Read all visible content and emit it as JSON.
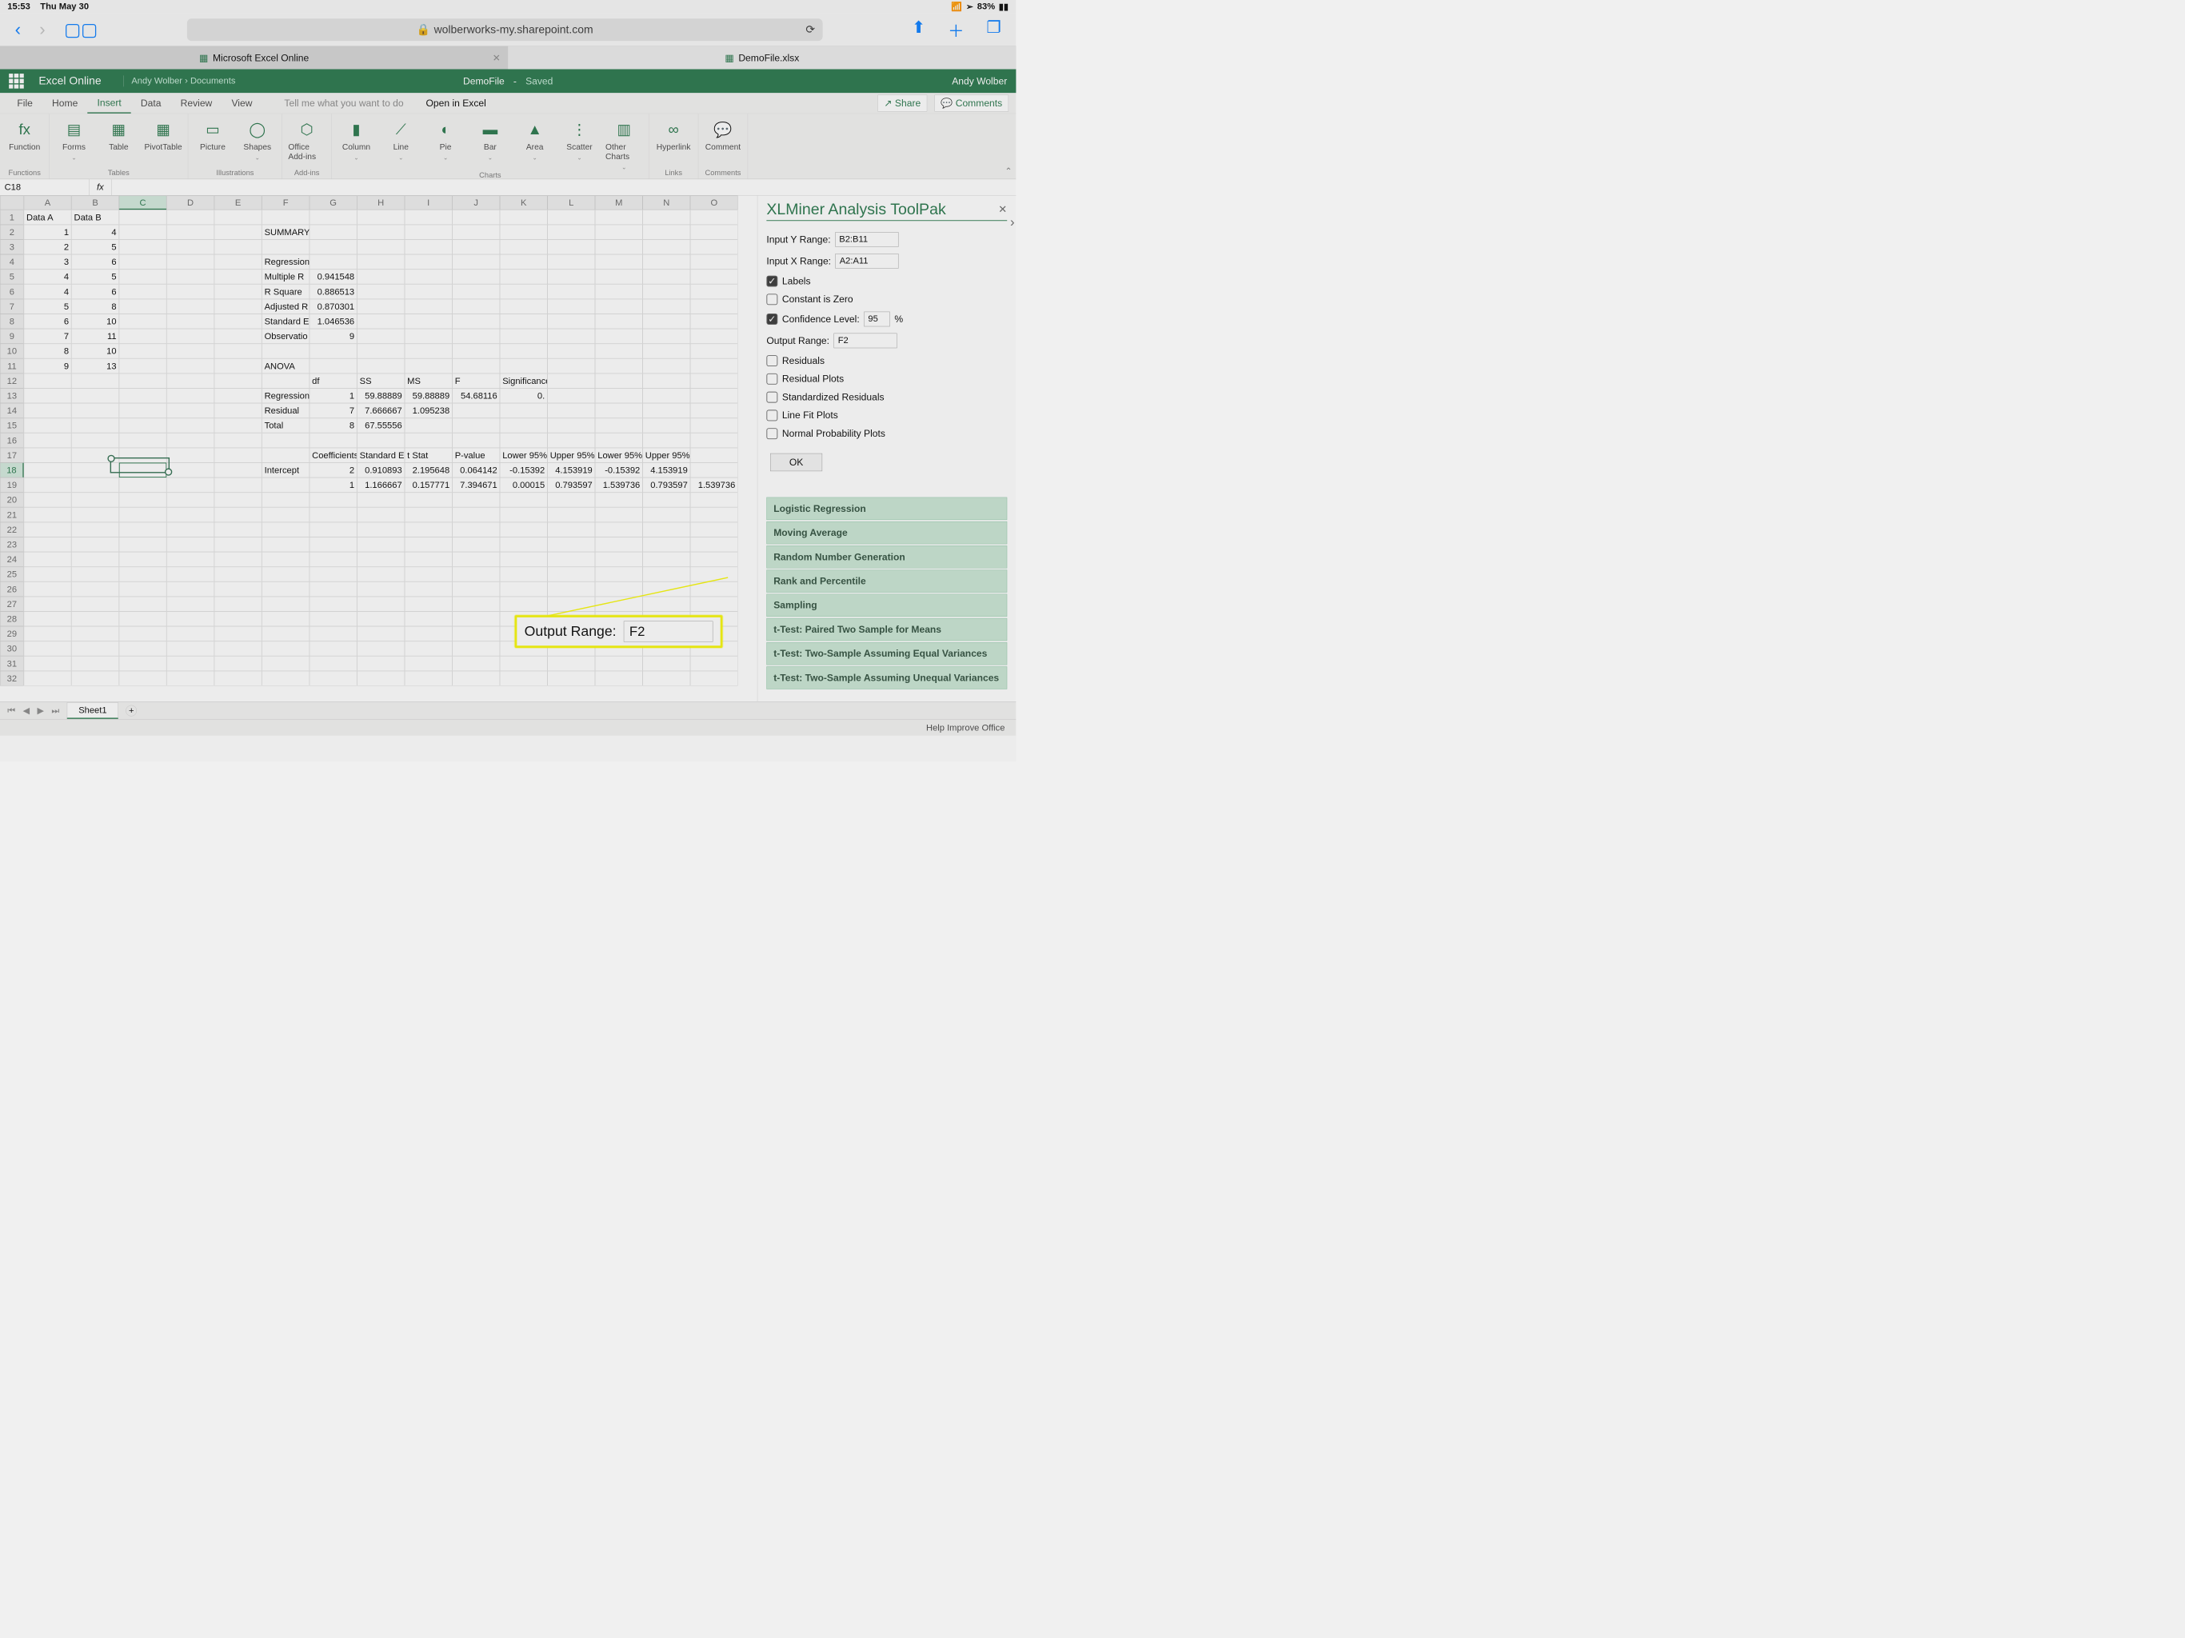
{
  "ios": {
    "time": "15:53",
    "date": "Thu May 30",
    "battery": "83%"
  },
  "safari": {
    "url": "wolberworks-my.sharepoint.com"
  },
  "tabs": [
    {
      "label": "Microsoft Excel Online"
    },
    {
      "label": "DemoFile.xlsx"
    }
  ],
  "excel": {
    "app": "Excel Online",
    "user": "Andy Wolber",
    "breadcrumb_user": "Andy Wolber",
    "breadcrumb_sep": "›",
    "breadcrumb_loc": "Documents",
    "doc": "DemoFile",
    "dash": "-",
    "status": "Saved"
  },
  "ribbonTabs": [
    "File",
    "Home",
    "Insert",
    "Data",
    "Review",
    "View"
  ],
  "tellme": "Tell me what you want to do",
  "openin": "Open in Excel",
  "share": "Share",
  "comments": "Comments",
  "ribbon": {
    "groups": [
      {
        "name": "Functions",
        "items": [
          "Function"
        ]
      },
      {
        "name": "Tables",
        "items": [
          "Forms",
          "Table",
          "PivotTable"
        ]
      },
      {
        "name": "Illustrations",
        "items": [
          "Picture",
          "Shapes"
        ]
      },
      {
        "name": "Add-ins",
        "items": [
          "Office Add-ins"
        ]
      },
      {
        "name": "Charts",
        "items": [
          "Column",
          "Line",
          "Pie",
          "Bar",
          "Area",
          "Scatter",
          "Other Charts"
        ]
      },
      {
        "name": "Links",
        "items": [
          "Hyperlink"
        ]
      },
      {
        "name": "Comments",
        "items": [
          "Comment"
        ]
      }
    ]
  },
  "namebox": "C18",
  "columns": [
    "A",
    "B",
    "C",
    "D",
    "E",
    "F",
    "G",
    "H",
    "I",
    "J",
    "K",
    "L",
    "M",
    "N",
    "O"
  ],
  "rowsData": [
    [
      "Data A",
      "Data B",
      "",
      "",
      "",
      "",
      "",
      "",
      "",
      "",
      "",
      "",
      "",
      "",
      ""
    ],
    [
      "1",
      "4",
      "",
      "",
      "",
      "SUMMARY OUTPUT",
      "",
      "",
      "",
      "",
      "",
      "",
      "",
      "",
      ""
    ],
    [
      "2",
      "5",
      "",
      "",
      "",
      "",
      "",
      "",
      "",
      "",
      "",
      "",
      "",
      "",
      ""
    ],
    [
      "3",
      "6",
      "",
      "",
      "",
      "Regression Statistics",
      "",
      "",
      "",
      "",
      "",
      "",
      "",
      "",
      ""
    ],
    [
      "4",
      "5",
      "",
      "",
      "",
      "Multiple R",
      "0.941548",
      "",
      "",
      "",
      "",
      "",
      "",
      "",
      ""
    ],
    [
      "4",
      "6",
      "",
      "",
      "",
      "R Square",
      "0.886513",
      "",
      "",
      "",
      "",
      "",
      "",
      "",
      ""
    ],
    [
      "5",
      "8",
      "",
      "",
      "",
      "Adjusted R",
      "0.870301",
      "",
      "",
      "",
      "",
      "",
      "",
      "",
      ""
    ],
    [
      "6",
      "10",
      "",
      "",
      "",
      "Standard E",
      "1.046536",
      "",
      "",
      "",
      "",
      "",
      "",
      "",
      ""
    ],
    [
      "7",
      "11",
      "",
      "",
      "",
      "Observatio",
      "9",
      "",
      "",
      "",
      "",
      "",
      "",
      "",
      ""
    ],
    [
      "8",
      "10",
      "",
      "",
      "",
      "",
      "",
      "",
      "",
      "",
      "",
      "",
      "",
      "",
      ""
    ],
    [
      "9",
      "13",
      "",
      "",
      "",
      "ANOVA",
      "",
      "",
      "",
      "",
      "",
      "",
      "",
      "",
      ""
    ],
    [
      "",
      "",
      "",
      "",
      "",
      "",
      "df",
      "SS",
      "MS",
      "F",
      "Significance F",
      "",
      "",
      "",
      ""
    ],
    [
      "",
      "",
      "",
      "",
      "",
      "Regression",
      "1",
      "59.88889",
      "59.88889",
      "54.68116",
      "0.",
      "",
      "",
      "",
      ""
    ],
    [
      "",
      "",
      "",
      "",
      "",
      "Residual",
      "7",
      "7.666667",
      "1.095238",
      "",
      "",
      "",
      "",
      "",
      ""
    ],
    [
      "",
      "",
      "",
      "",
      "",
      "Total",
      "8",
      "67.55556",
      "",
      "",
      "",
      "",
      "",
      "",
      ""
    ],
    [
      "",
      "",
      "",
      "",
      "",
      "",
      "",
      "",
      "",
      "",
      "",
      "",
      "",
      "",
      ""
    ],
    [
      "",
      "",
      "",
      "",
      "",
      "",
      "Coefficients",
      "Standard E",
      "t Stat",
      "P-value",
      "Lower 95%",
      "Upper 95%",
      "Lower 95%",
      "Upper 95%",
      ""
    ],
    [
      "",
      "",
      "",
      "",
      "",
      "Intercept",
      "2",
      "0.910893",
      "2.195648",
      "0.064142",
      "-0.15392",
      "4.153919",
      "-0.15392",
      "4.153919",
      ""
    ],
    [
      "",
      "",
      "",
      "",
      "",
      "",
      "1",
      "1.166667",
      "0.157771",
      "7.394671",
      "0.00015",
      "0.793597",
      "1.539736",
      "0.793597",
      "1.539736"
    ],
    [
      "",
      "",
      "",
      "",
      "",
      "",
      "",
      "",
      "",
      "",
      "",
      "",
      "",
      "",
      ""
    ],
    [
      "",
      "",
      "",
      "",
      "",
      "",
      "",
      "",
      "",
      "",
      "",
      "",
      "",
      "",
      ""
    ],
    [
      "",
      "",
      "",
      "",
      "",
      "",
      "",
      "",
      "",
      "",
      "",
      "",
      "",
      "",
      ""
    ],
    [
      "",
      "",
      "",
      "",
      "",
      "",
      "",
      "",
      "",
      "",
      "",
      "",
      "",
      "",
      ""
    ],
    [
      "",
      "",
      "",
      "",
      "",
      "",
      "",
      "",
      "",
      "",
      "",
      "",
      "",
      "",
      ""
    ],
    [
      "",
      "",
      "",
      "",
      "",
      "",
      "",
      "",
      "",
      "",
      "",
      "",
      "",
      "",
      ""
    ],
    [
      "",
      "",
      "",
      "",
      "",
      "",
      "",
      "",
      "",
      "",
      "",
      "",
      "",
      "",
      ""
    ],
    [
      "",
      "",
      "",
      "",
      "",
      "",
      "",
      "",
      "",
      "",
      "",
      "",
      "",
      "",
      ""
    ],
    [
      "",
      "",
      "",
      "",
      "",
      "",
      "",
      "",
      "",
      "",
      "",
      "",
      "",
      "",
      ""
    ],
    [
      "",
      "",
      "",
      "",
      "",
      "",
      "",
      "",
      "",
      "",
      "",
      "",
      "",
      "",
      ""
    ],
    [
      "",
      "",
      "",
      "",
      "",
      "",
      "",
      "",
      "",
      "",
      "",
      "",
      "",
      "",
      ""
    ],
    [
      "",
      "",
      "",
      "",
      "",
      "",
      "",
      "",
      "",
      "",
      "",
      "",
      "",
      "",
      ""
    ],
    [
      "",
      "",
      "",
      "",
      "",
      "",
      "",
      "",
      "",
      "",
      "",
      "",
      "",
      "",
      ""
    ]
  ],
  "toolpak": {
    "title": "XLMiner Analysis ToolPak",
    "inputY_label": "Input Y Range:",
    "inputY": "B2:B11",
    "inputX_label": "Input X Range:",
    "inputX": "A2:A11",
    "labels": "Labels",
    "constZero": "Constant is Zero",
    "confLevel_label": "Confidence Level:",
    "confLevel": "95",
    "pct": "%",
    "outRange_label": "Output Range:",
    "outRange": "F2",
    "residuals": "Residuals",
    "residualPlots": "Residual Plots",
    "stdResiduals": "Standardized Residuals",
    "lineFit": "Line Fit Plots",
    "normalProb": "Normal Probability Plots",
    "ok": "OK",
    "methods": [
      "Logistic Regression",
      "Moving Average",
      "Random Number Generation",
      "Rank and Percentile",
      "Sampling",
      "t-Test: Paired Two Sample for Means",
      "t-Test: Two-Sample Assuming Equal Variances",
      "t-Test: Two-Sample Assuming Unequal Variances"
    ]
  },
  "callout": {
    "label": "Output Range:",
    "value": "F2"
  },
  "sheet": "Sheet1",
  "footer": "Help Improve Office"
}
